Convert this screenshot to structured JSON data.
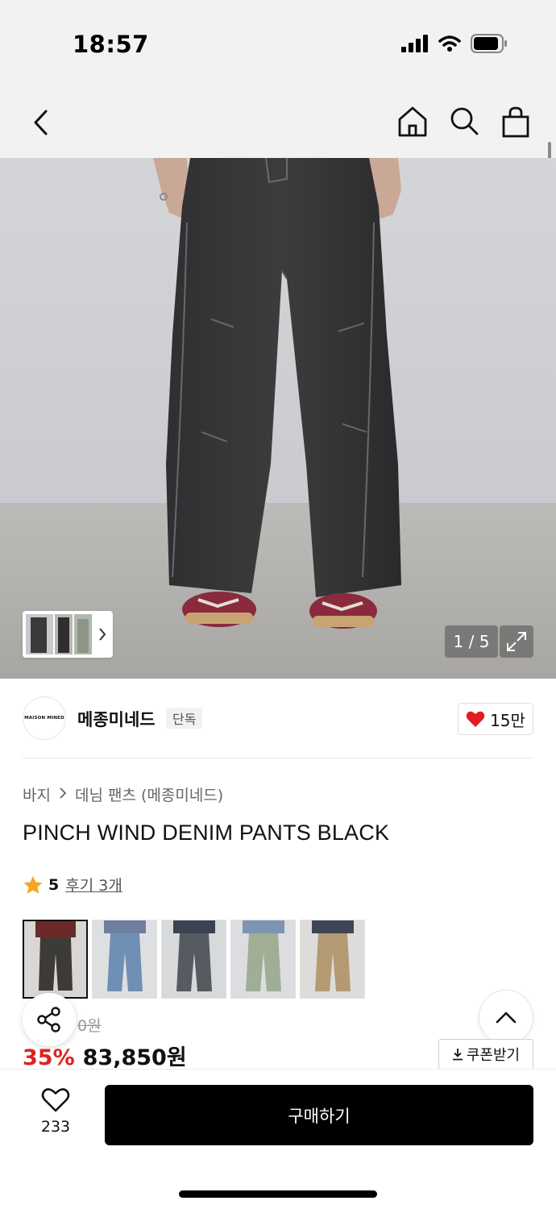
{
  "status_bar": {
    "time": "18:57",
    "icons": [
      "signal-icon",
      "wifi-icon",
      "battery-icon"
    ]
  },
  "nav": {
    "icons": [
      "back-chevron-icon",
      "home-icon",
      "search-icon",
      "shopping-bag-icon"
    ]
  },
  "gallery": {
    "counter": "1 / 5",
    "expand_icon": "expand-icon",
    "thumb_strip_icon": "chevron-right-icon"
  },
  "brand": {
    "logo_text": "MAISON MINED",
    "name": "메종미네드",
    "badge": "단독",
    "like_count": "15만"
  },
  "breadcrumb": {
    "items": [
      "바지",
      "데님 팬츠 (메종미네드)"
    ]
  },
  "product": {
    "title": "PINCH WIND DENIM PANTS BLACK",
    "rating": "5",
    "review_link": "후기 3개",
    "original_price_visible": "0원",
    "discount": "35%",
    "sale_price": "83,850원",
    "coupon_label": "쿠폰받기"
  },
  "color_options": [
    {
      "name": "black",
      "selected": true,
      "color": "#3d3b38"
    },
    {
      "name": "light-blue",
      "selected": false,
      "color": "#6f8fb4"
    },
    {
      "name": "grey",
      "selected": false,
      "color": "#555b60"
    },
    {
      "name": "sage",
      "selected": false,
      "color": "#9fae95"
    },
    {
      "name": "beige",
      "selected": false,
      "color": "#b49a72"
    }
  ],
  "bottom_bar": {
    "wishlist_count": "233",
    "buy_label": "구매하기"
  },
  "colors": {
    "accent_red": "#e02020",
    "heart_red": "#e31b23",
    "buy_button": "#000000"
  }
}
